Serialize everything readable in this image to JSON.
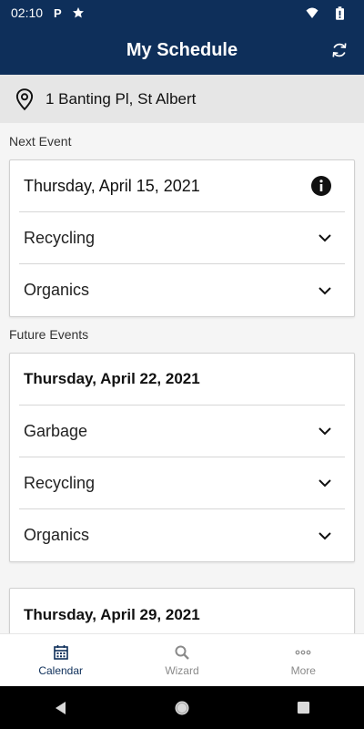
{
  "status": {
    "time": "02:10"
  },
  "header": {
    "title": "My Schedule"
  },
  "address": {
    "text": "1 Banting Pl, St Albert"
  },
  "sections": {
    "next_label": "Next Event",
    "future_label": "Future Events"
  },
  "next_event": {
    "date": "Thursday, April 15, 2021",
    "items": [
      "Recycling",
      "Organics"
    ]
  },
  "future_events": [
    {
      "date": "Thursday, April 22, 2021",
      "items": [
        "Garbage",
        "Recycling",
        "Organics"
      ]
    },
    {
      "date": "Thursday, April 29, 2021",
      "items": []
    }
  ],
  "nav": {
    "calendar": "Calendar",
    "wizard": "Wizard",
    "more": "More"
  },
  "colors": {
    "brand": "#0e2f5a",
    "content_bg": "#f5f5f5",
    "address_bg": "#e6e6e6"
  },
  "icons": [
    "parking-icon",
    "star-icon",
    "wifi-icon",
    "battery-icon",
    "refresh-icon",
    "location-pin-icon",
    "info-icon",
    "chevron-down-icon",
    "calendar-icon",
    "search-icon",
    "more-dots-icon",
    "back-icon",
    "home-icon",
    "recents-icon"
  ]
}
